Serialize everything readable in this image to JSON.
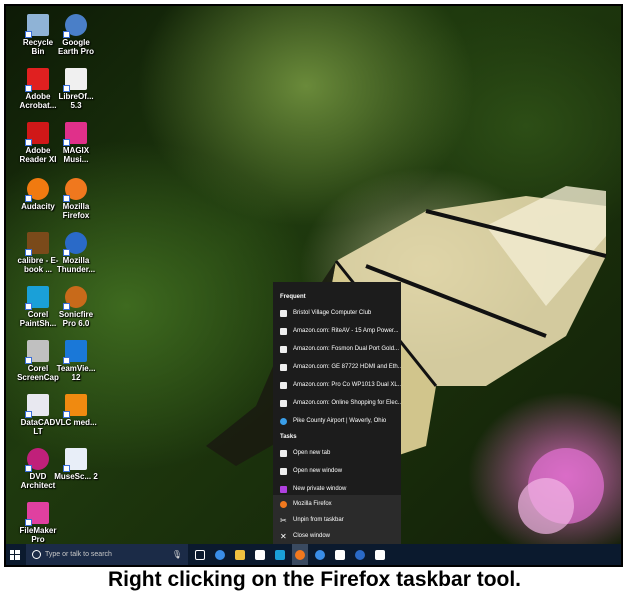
{
  "desktop_icons": [
    {
      "label": "Recycle Bin",
      "icon": "recycle-bin-icon",
      "color": "#8fb3d6"
    },
    {
      "label": "Google Earth Pro",
      "icon": "google-earth-icon",
      "color": "#4a7fc8"
    },
    {
      "label": "Adobe Acrobat...",
      "icon": "acrobat-icon",
      "color": "#e02020"
    },
    {
      "label": "LibreOf... 5.3",
      "icon": "libreoffice-icon",
      "color": "#f0f0f0"
    },
    {
      "label": "Adobe Reader XI",
      "icon": "adobe-reader-icon",
      "color": "#d01818"
    },
    {
      "label": "MAGIX Musi...",
      "icon": "magix-icon",
      "color": "#e0308a"
    },
    {
      "label": "Audacity",
      "icon": "audacity-icon",
      "color": "#f07a10"
    },
    {
      "label": "Mozilla Firefox",
      "icon": "firefox-icon",
      "color": "#f0781e"
    },
    {
      "label": "calibre - E-book ...",
      "icon": "calibre-icon",
      "color": "#7a4a1a"
    },
    {
      "label": "Mozilla Thunder...",
      "icon": "thunderbird-icon",
      "color": "#2a6ac8"
    },
    {
      "label": "Corel PaintSh...",
      "icon": "paintshop-icon",
      "color": "#1aa0d8"
    },
    {
      "label": "Sonicfire Pro 6.0",
      "icon": "sonicfire-icon",
      "color": "#c86a1a"
    },
    {
      "label": "Corel ScreenCap",
      "icon": "screencap-icon",
      "color": "#c0c0c0"
    },
    {
      "label": "TeamVie... 12",
      "icon": "teamviewer-icon",
      "color": "#1a78d8"
    },
    {
      "label": "DataCAD LT",
      "icon": "datacad-icon",
      "color": "#e8e8f0"
    },
    {
      "label": "VLC med...",
      "icon": "vlc-icon",
      "color": "#f08a10"
    },
    {
      "label": "DVD Architect",
      "icon": "dvd-architect-icon",
      "color": "#c0207a"
    },
    {
      "label": "MuseSc... 2",
      "icon": "musescore-icon",
      "color": "#e8eef8"
    },
    {
      "label": "FileMaker Pro",
      "icon": "filemaker-icon",
      "color": "#e040a0"
    }
  ],
  "jumplist": {
    "frequent_header": "Frequent",
    "frequent": [
      "Bristol Village Computer Club",
      "Amazon.com: RiteAV - 15 Amp Power...",
      "Amazon.com: Fosmon Dual Port Gold...",
      "Amazon.com: GE 87722 HDMI and Eth...",
      "Amazon.com: Pro Co WP1013 Dual XL...",
      "Amazon.com: Online Shopping for Elec...",
      "Pike County Airport | Waverly, Ohio"
    ],
    "tasks_header": "Tasks",
    "tasks": [
      "Open new tab",
      "Open new window",
      "New private window"
    ],
    "bottom": [
      "Mozilla Firefox",
      "Unpin from taskbar",
      "Close window"
    ]
  },
  "taskbar": {
    "search_placeholder": "Type or talk to search",
    "pinned": [
      {
        "name": "task-view-icon",
        "color": "#ffffff"
      },
      {
        "name": "edge-icon",
        "color": "#3a8ee8"
      },
      {
        "name": "file-explorer-icon",
        "color": "#f0c040"
      },
      {
        "name": "store-icon",
        "color": "#ffffff"
      },
      {
        "name": "paintshop-taskbar-icon",
        "color": "#1aa0d8"
      },
      {
        "name": "firefox-taskbar-icon",
        "color": "#f0781e"
      },
      {
        "name": "chrome-icon",
        "color": "#3a8ee8"
      },
      {
        "name": "document-icon",
        "color": "#ffffff"
      },
      {
        "name": "thunderbird-taskbar-icon",
        "color": "#2a6ac8"
      },
      {
        "name": "file-icon",
        "color": "#ffffff"
      }
    ]
  },
  "caption": "Right clicking on the Firefox taskbar tool."
}
